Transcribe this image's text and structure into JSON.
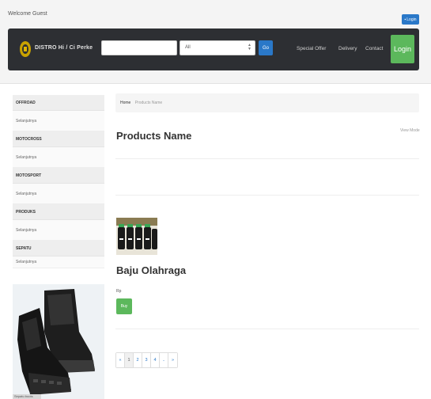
{
  "topbar": {
    "welcome": "Welcome Guest",
    "button_label": "Login"
  },
  "navbar": {
    "brand": "DISTRO Hi / Ci Perke",
    "search": {
      "value": "",
      "placeholder": ""
    },
    "category": {
      "selected": "All"
    },
    "go_label": "Go",
    "links": [
      "Special Offer",
      "Delivery",
      "Contact"
    ],
    "login_label": "Login"
  },
  "sidebar": {
    "categories": [
      {
        "name": "OFFROAD",
        "sub": "Selanjutnya"
      },
      {
        "name": "MOTOCROSS",
        "sub": "Selanjutnya"
      },
      {
        "name": "MOTOSPORT",
        "sub": "Selanjutnya"
      },
      {
        "name": "PRODUKS",
        "sub": "Selanjutnya"
      },
      {
        "name": "SEPATU",
        "sub": "Selanjutnya"
      }
    ],
    "image_caption": "Sepatu boots"
  },
  "main": {
    "breadcrumb": {
      "home": "Home",
      "current": "Products Name"
    },
    "title": "Products Name",
    "sort": "View Mode",
    "product": {
      "name": "Baju Olahraga",
      "price": "Rp",
      "button_label": "Buy"
    },
    "pagination": [
      "«",
      "1",
      "2",
      "3",
      "4",
      "..",
      "»"
    ]
  },
  "colors": {
    "navbar": "#2d2f33",
    "accent_blue": "#2a78c8",
    "accent_green": "#5cb85c"
  }
}
